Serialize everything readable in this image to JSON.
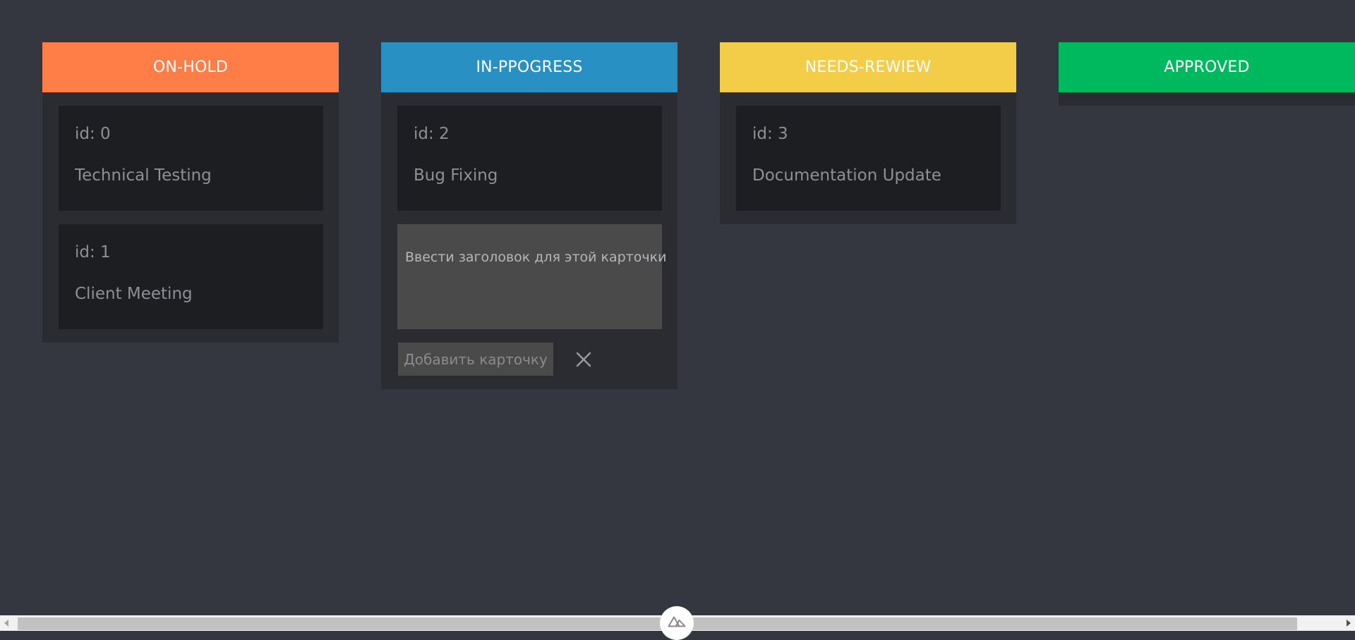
{
  "columns": [
    {
      "title": "ON-HOLD",
      "color": "#ff7e48",
      "cards": [
        {
          "id": "id: 0",
          "title": "Technical Testing"
        },
        {
          "id": "id: 1",
          "title": "Client Meeting"
        }
      ]
    },
    {
      "title": "IN-PPOGRESS",
      "color": "#2990c3",
      "cards": [
        {
          "id": "id: 2",
          "title": "Bug Fixing"
        }
      ],
      "composer": {
        "placeholder": "Ввести заголовок для этой карточки",
        "add_label": "Добавить карточку"
      }
    },
    {
      "title": "NEEDS-REWIEW",
      "color": "#f3cd48",
      "cards": [
        {
          "id": "id: 3",
          "title": "Documentation Update"
        }
      ]
    },
    {
      "title": "APPROVED",
      "color": "#00b95e",
      "cards": []
    }
  ],
  "icons": {
    "close": "close-icon",
    "nuxt": "nuxt-logo-icon"
  },
  "colors": {
    "background": "#343640",
    "column_bg": "#2b2c31",
    "card_bg": "#1d1e22"
  }
}
